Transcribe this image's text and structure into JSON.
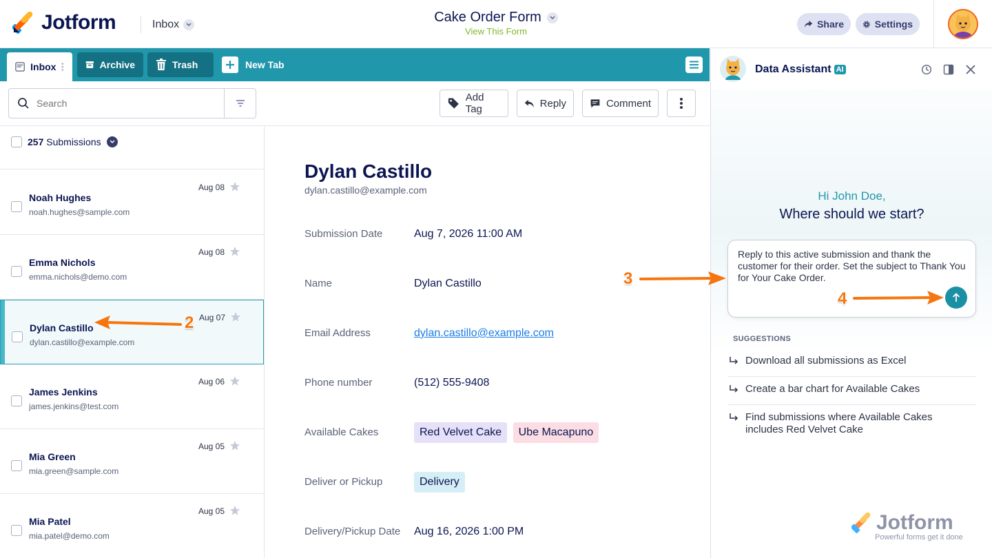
{
  "header": {
    "logo_text": "Jotform",
    "inbox_label": "Inbox",
    "form_title": "Cake Order Form",
    "view_form": "View This Form",
    "share_label": "Share",
    "settings_label": "Settings"
  },
  "tabs": {
    "inbox": "Inbox",
    "archive": "Archive",
    "trash": "Trash",
    "new_tab": "New Tab"
  },
  "toolbar": {
    "search_placeholder": "Search",
    "add_tag": "Add Tag",
    "reply": "Reply",
    "comment": "Comment"
  },
  "list": {
    "count": "257",
    "count_label": "Submissions",
    "rows": [
      {
        "name": "Noah Hughes",
        "email": "noah.hughes@sample.com",
        "date": "Aug 08"
      },
      {
        "name": "Emma Nichols",
        "email": "emma.nichols@demo.com",
        "date": "Aug 08"
      },
      {
        "name": "Dylan Castillo",
        "email": "dylan.castillo@example.com",
        "date": "Aug 07"
      },
      {
        "name": "James Jenkins",
        "email": "james.jenkins@test.com",
        "date": "Aug 06"
      },
      {
        "name": "Mia Green",
        "email": "mia.green@sample.com",
        "date": "Aug 05"
      },
      {
        "name": "Mia Patel",
        "email": "mia.patel@demo.com",
        "date": "Aug 05"
      }
    ]
  },
  "detail": {
    "name": "Dylan Castillo",
    "email": "dylan.castillo@example.com",
    "fields": [
      {
        "label": "Submission Date",
        "value": "Aug 7, 2026 11:00 AM"
      },
      {
        "label": "Name",
        "value": "Dylan Castillo"
      },
      {
        "label": "Email Address",
        "value": "dylan.castillo@example.com"
      },
      {
        "label": "Phone number",
        "value": "(512) 555-9408"
      },
      {
        "label": "Available Cakes",
        "tags": [
          "Red Velvet Cake",
          "Ube Macapuno"
        ]
      },
      {
        "label": "Deliver or Pickup",
        "tags": [
          "Delivery"
        ]
      },
      {
        "label": "Delivery/Pickup Date",
        "value": "Aug 16, 2026 1:00 PM"
      }
    ]
  },
  "assistant": {
    "title": "Data Assistant",
    "badge": "AI",
    "greeting": "Hi John Doe,",
    "prompt_question": "Where should we start?",
    "input_text": "Reply to this active submission and thank the customer for their order. Set the subject to Thank You for Your Cake Order.",
    "suggestions_heading": "SUGGESTIONS",
    "suggestions": [
      "Download all submissions as Excel",
      "Create a bar chart for Available Cakes",
      "Find submissions where Available Cakes includes Red Velvet Cake"
    ],
    "watermark_logo": "Jotform",
    "watermark_tagline": "Powerful forms get it done"
  },
  "annotations": {
    "step2": "2",
    "step3": "3",
    "step4": "4"
  },
  "colors": {
    "tab_bar": "#2197ac",
    "accent_orange": "#f5760f",
    "tag_purple": "#e6e0f8",
    "tag_pink": "#fbdde3",
    "tag_blue": "#d6eef6"
  }
}
